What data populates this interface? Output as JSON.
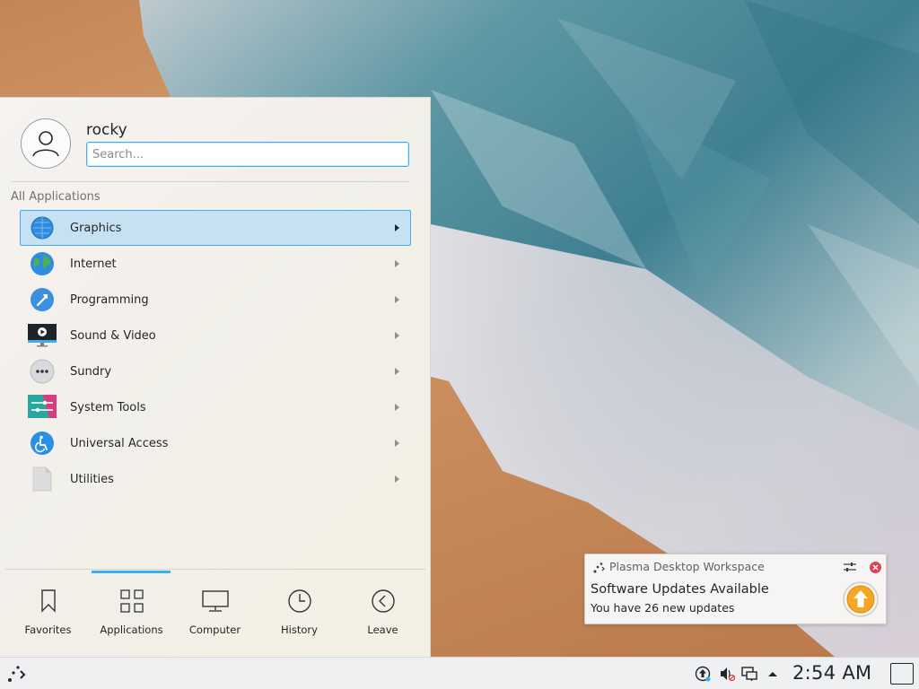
{
  "launcher": {
    "username": "rocky",
    "search_placeholder": "Search...",
    "section_title": "All Applications",
    "items": [
      {
        "label": "Graphics",
        "icon": "graphics-icon",
        "selected": true
      },
      {
        "label": "Internet",
        "icon": "internet-icon",
        "selected": false
      },
      {
        "label": "Programming",
        "icon": "programming-icon",
        "selected": false
      },
      {
        "label": "Sound & Video",
        "icon": "sound-video-icon",
        "selected": false
      },
      {
        "label": "Sundry",
        "icon": "sundry-icon",
        "selected": false
      },
      {
        "label": "System Tools",
        "icon": "system-tools-icon",
        "selected": false
      },
      {
        "label": "Universal Access",
        "icon": "universal-access-icon",
        "selected": false
      },
      {
        "label": "Utilities",
        "icon": "utilities-icon",
        "selected": false
      }
    ],
    "tabs": [
      {
        "label": "Favorites",
        "icon": "bookmark-icon",
        "active": false
      },
      {
        "label": "Applications",
        "icon": "grid-icon",
        "active": true
      },
      {
        "label": "Computer",
        "icon": "monitor-icon",
        "active": false
      },
      {
        "label": "History",
        "icon": "clock-icon",
        "active": false
      },
      {
        "label": "Leave",
        "icon": "back-arrow-icon",
        "active": false
      }
    ]
  },
  "notification": {
    "app_name": "Plasma Desktop Workspace",
    "title": "Software Updates Available",
    "body": "You have 26 new updates"
  },
  "taskbar": {
    "clock": "2:54 AM",
    "tray_icons": [
      "updates-icon",
      "volume-muted-icon",
      "network-icon",
      "expand-tray-icon"
    ]
  },
  "colors": {
    "accent": "#3daee9",
    "selection_bg": "#c6e2f2",
    "close_red": "#da4453",
    "update_orange": "#f39c1f"
  }
}
